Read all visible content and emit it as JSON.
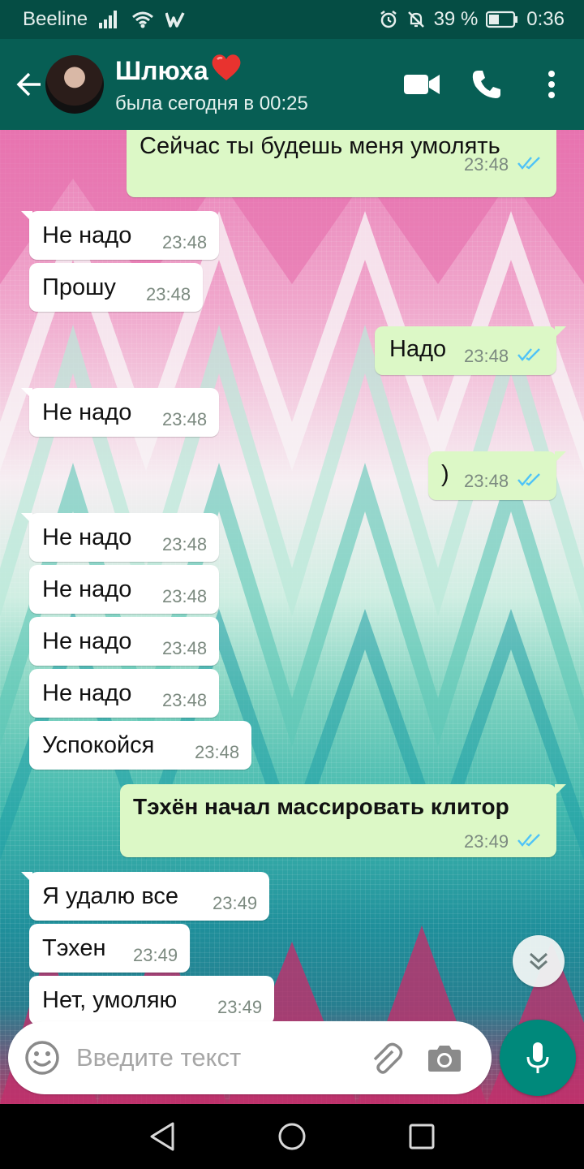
{
  "status_bar": {
    "carrier": "Beeline",
    "battery_percent": "39 %",
    "time": "0:36",
    "icons": [
      "signal-icon",
      "wifi-icon",
      "whatsapp-w-icon",
      "alarm-icon",
      "muted-bell-icon",
      "battery-icon"
    ]
  },
  "header": {
    "contact_name": "Шлюха",
    "last_seen": "была сегодня в 00:25",
    "icons": [
      "back-arrow-icon",
      "avatar",
      "heart-emoji",
      "video-call-icon",
      "phone-icon",
      "more-vert-icon"
    ]
  },
  "messages": [
    {
      "dir": "out",
      "text": "Сейчас ты будешь меня умолять",
      "time": "23:48",
      "read": true
    },
    {
      "dir": "in",
      "text": "Не надо",
      "time": "23:48"
    },
    {
      "dir": "in",
      "text": "Прошу",
      "time": "23:48"
    },
    {
      "dir": "out",
      "text": "Надо",
      "time": "23:48",
      "read": true
    },
    {
      "dir": "in",
      "text": "Не надо",
      "time": "23:48"
    },
    {
      "dir": "out",
      "text": ")",
      "time": "23:48",
      "read": true
    },
    {
      "dir": "in",
      "text": "Не надо",
      "time": "23:48"
    },
    {
      "dir": "in",
      "text": "Не надо",
      "time": "23:48"
    },
    {
      "dir": "in",
      "text": "Не надо",
      "time": "23:48"
    },
    {
      "dir": "in",
      "text": "Не надо",
      "time": "23:48"
    },
    {
      "dir": "in",
      "text": "Успокойся",
      "time": "23:48"
    },
    {
      "dir": "out",
      "text": "Тэхён начал массировать клитор",
      "time": "23:49",
      "read": true,
      "bold": true
    },
    {
      "dir": "in",
      "text": "Я удалю все",
      "time": "23:49"
    },
    {
      "dir": "in",
      "text": "Тэхен",
      "time": "23:49"
    },
    {
      "dir": "in",
      "text": "Нет, умоляю",
      "time": "23:49"
    }
  ],
  "input": {
    "placeholder": "Введите текст",
    "icons": [
      "emoji-icon",
      "attach-icon",
      "camera-icon",
      "mic-icon"
    ]
  },
  "colors": {
    "header": "#075e54",
    "status_bar": "#054d44",
    "outgoing_bubble": "#dcf8c6",
    "incoming_bubble": "#ffffff",
    "read_ticks": "#4fc3f7",
    "mic_button": "#00897b"
  }
}
